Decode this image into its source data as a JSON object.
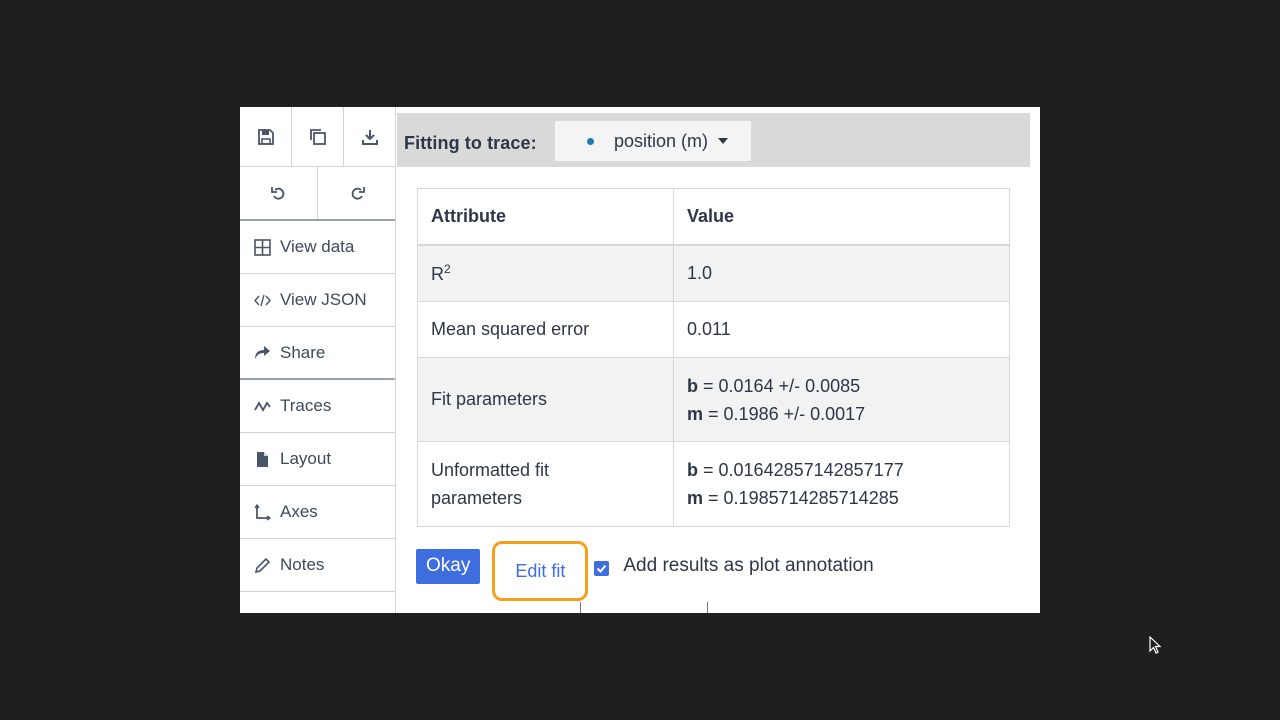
{
  "sidebar": {
    "toolbar_row1": [
      {
        "icon": "save-icon"
      },
      {
        "icon": "copy-icon"
      },
      {
        "icon": "download-icon"
      }
    ],
    "toolbar_row2": [
      {
        "icon": "undo-icon"
      },
      {
        "icon": "redo-icon"
      }
    ],
    "items": [
      {
        "label": "View data",
        "icon": "grid-icon"
      },
      {
        "label": "View JSON",
        "icon": "code-icon"
      },
      {
        "label": "Share",
        "icon": "share-icon"
      },
      {
        "label": "Traces",
        "icon": "trace-wave-icon"
      },
      {
        "label": "Layout",
        "icon": "document-icon"
      },
      {
        "label": "Axes",
        "icon": "axes-icon"
      },
      {
        "label": "Notes",
        "icon": "pencil-icon"
      }
    ]
  },
  "fit_panel": {
    "label": "Fitting to trace:",
    "trace": {
      "name": "position (m)",
      "color": "#1f77b4"
    },
    "table": {
      "headers": [
        "Attribute",
        "Value"
      ],
      "r2": {
        "label": "R",
        "sup": "2",
        "value": "1.0"
      },
      "mse": {
        "label": "Mean squared error",
        "value": "0.011"
      },
      "fit_params": {
        "label": "Fit parameters",
        "b_name": "b",
        "b_value": "= 0.0164 +/- 0.0085",
        "m_name": "m",
        "m_value": "= 0.1986 +/- 0.0017"
      },
      "unformatted": {
        "label_line1": "Unformatted fit",
        "label_line2": "parameters",
        "b_name": "b",
        "b_value": "= 0.01642857142857177",
        "m_name": "m",
        "m_value": "= 0.1985714285714285"
      }
    },
    "buttons": {
      "okay": "Okay",
      "edit_fit": "Edit fit"
    },
    "annotation_checkbox": {
      "label": "Add results as plot annotation",
      "checked": true
    }
  },
  "colors": {
    "accent": "#3e6de0",
    "highlight": "#f5a01a",
    "background": "#1f1f1f"
  }
}
